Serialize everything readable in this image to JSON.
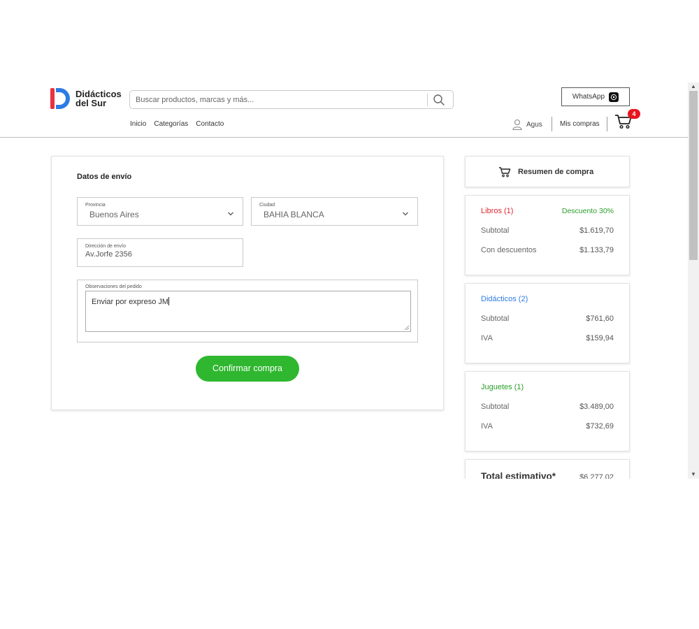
{
  "header": {
    "logo_line1": "Didácticos",
    "logo_line2": "del Sur",
    "search_placeholder": "Buscar productos, marcas y más...",
    "whatsapp_label": "WhatsApp",
    "nav": [
      "Inicio",
      "Categorías",
      "Contacto"
    ],
    "user_name": "Agus",
    "mis_compras": "Mis compras",
    "cart_count": "4",
    "colors": {
      "logo_red": "#e8333f",
      "logo_blue": "#2d7be4",
      "badge": "#e8151e"
    }
  },
  "form": {
    "title": "Datos de envío",
    "provincia_label": "Provincia",
    "provincia_value": "Buenos Aires",
    "ciudad_label": "Ciudad",
    "ciudad_value": "BAHIA BLANCA",
    "direccion_label": "Dirección de envío",
    "direccion_value": "Av.Jorfe 2356",
    "observaciones_label": "Observaciones del pedido",
    "observaciones_value": "Enviar por expreso JM",
    "confirm_label": "Confirmar compra",
    "confirm_color": "#2fb72f"
  },
  "summary": {
    "title": "Resumen de compra",
    "libros": {
      "title": "Libros (1)",
      "discount": "Descuento 30%",
      "subtotal_label": "Subtotal",
      "subtotal_value": "$1.619,70",
      "con_desc_label": "Con descuentos",
      "con_desc_value": "$1.133,79"
    },
    "didacticos": {
      "title": "Didácticos (2)",
      "subtotal_label": "Subtotal",
      "subtotal_value": "$761,60",
      "iva_label": "IVA",
      "iva_value": "$159,94"
    },
    "juguetes": {
      "title": "Juguetes (1)",
      "subtotal_label": "Subtotal",
      "subtotal_value": "$3.489,00",
      "iva_label": "IVA",
      "iva_value": "$732,69"
    },
    "total_label": "Total estimativo*",
    "total_value": "$6.277,02"
  }
}
